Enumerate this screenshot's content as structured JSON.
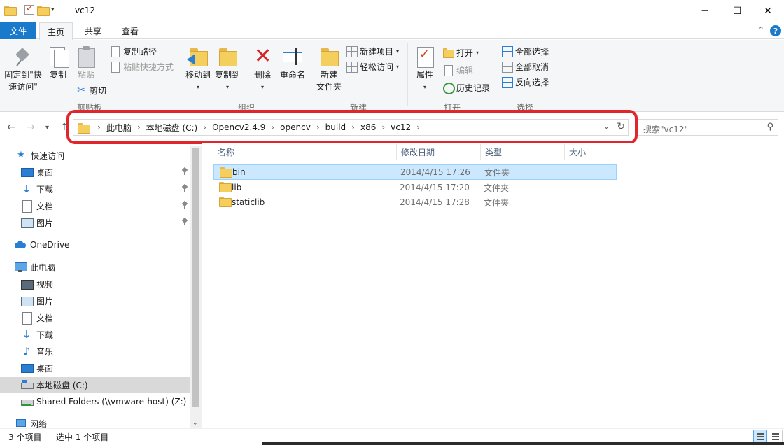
{
  "window": {
    "title": "vc12",
    "minimize": "─",
    "maximize": "☐",
    "close": "✕"
  },
  "ribbon_tabs": [
    "文件",
    "主页",
    "共享",
    "查看"
  ],
  "ribbon": {
    "clipboard": {
      "pin_quick_access": [
        "固定到\"快",
        "速访问\""
      ],
      "copy": "复制",
      "paste": "粘贴",
      "copy_path": "复制路径",
      "paste_shortcut": "粘贴快捷方式",
      "cut": "剪切",
      "group_label": "剪贴板"
    },
    "organize": {
      "move_to": "移动到",
      "copy_to": "复制到",
      "delete": "删除",
      "rename": "重命名",
      "group_label": "组织"
    },
    "new": {
      "new_folder": [
        "新建",
        "文件夹"
      ],
      "new_item": "新建项目",
      "easy_access": "轻松访问",
      "group_label": "新建"
    },
    "open": {
      "properties": "属性",
      "open": "打开",
      "edit": "编辑",
      "history": "历史记录",
      "group_label": "打开"
    },
    "select": {
      "select_all": "全部选择",
      "select_none": "全部取消",
      "invert": "反向选择",
      "group_label": "选择"
    }
  },
  "address": {
    "crumbs": [
      "此电脑",
      "本地磁盘 (C:)",
      "Opencv2.4.9",
      "opencv",
      "build",
      "x86",
      "vc12"
    ],
    "search_placeholder": "搜索\"vc12\""
  },
  "nav_pane": {
    "items": [
      {
        "label": "快速访问",
        "icon": "star-icon"
      },
      {
        "label": "桌面",
        "icon": "desktop-icon",
        "pinned": true
      },
      {
        "label": "下载",
        "icon": "download-icon",
        "pinned": true
      },
      {
        "label": "文档",
        "icon": "document-icon",
        "pinned": true
      },
      {
        "label": "图片",
        "icon": "picture-icon",
        "pinned": true
      },
      {
        "label": "OneDrive",
        "icon": "onedrive-icon"
      },
      {
        "label": "此电脑",
        "icon": "pc-icon"
      },
      {
        "label": "视频",
        "icon": "video-icon"
      },
      {
        "label": "图片",
        "icon": "picture-icon"
      },
      {
        "label": "文档",
        "icon": "document-icon"
      },
      {
        "label": "下载",
        "icon": "download-icon"
      },
      {
        "label": "音乐",
        "icon": "music-icon"
      },
      {
        "label": "桌面",
        "icon": "desktop-icon"
      },
      {
        "label": "本地磁盘 (C:)",
        "icon": "drive-icon",
        "selected": true
      },
      {
        "label": "Shared Folders (\\\\vmware-host) (Z:)",
        "icon": "network-drive-icon"
      },
      {
        "label": "网络",
        "icon": "network-icon"
      }
    ]
  },
  "file_list": {
    "columns": [
      "名称",
      "修改日期",
      "类型",
      "大小"
    ],
    "rows": [
      {
        "name": "bin",
        "date": "2014/4/15 17:26",
        "type": "文件夹",
        "selected": true
      },
      {
        "name": "lib",
        "date": "2014/4/15 17:20",
        "type": "文件夹"
      },
      {
        "name": "staticlib",
        "date": "2014/4/15 17:28",
        "type": "文件夹"
      }
    ]
  },
  "status": {
    "count": "3 个项目",
    "selected": "选中 1 个项目"
  },
  "colors": {
    "accent": "#1979ca",
    "highlight_box": "#e0252b",
    "selection": "#cce8ff"
  }
}
